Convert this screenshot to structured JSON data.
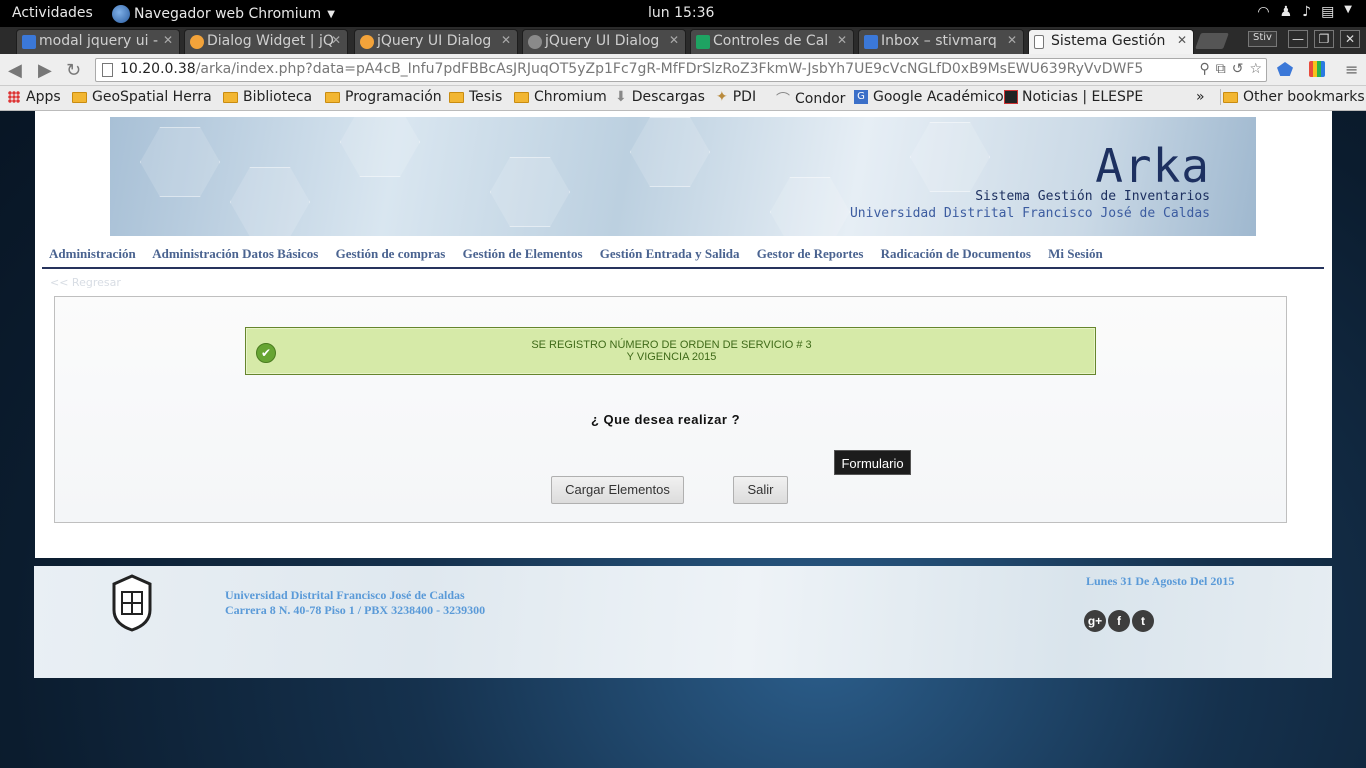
{
  "desktop": {
    "activities": "Actividades",
    "app_name": "Navegador web Chromium",
    "clock": "lun 15:36"
  },
  "tabs": [
    {
      "title": "modal jquery ui -",
      "icon_color": "#3b78d8"
    },
    {
      "title": "Dialog Widget | jQ",
      "icon_color": "#f3a33a"
    },
    {
      "title": "jQuery UI Dialog",
      "icon_color": "#f3a33a"
    },
    {
      "title": "jQuery UI Dialog",
      "icon_color": "#8a8a8a"
    },
    {
      "title": "Controles de Cal",
      "icon_color": "#1ea362"
    },
    {
      "title": "Inbox – stivmarq",
      "icon_color": "#3b78d8"
    },
    {
      "title": "Sistema Gestión",
      "icon_color": "#ffffff",
      "active": true
    }
  ],
  "browser": {
    "profile": "Stiv",
    "url_host": "10.20.0.38",
    "url_path": "/arka/index.php?data=pA4cB_Infu7pdFBBcAsJRJuqOT5yZp1Fc7gR-MfFDrSlzRoZ3FkmW-JsbYh7UE9cVcNGLfD0xB9MsEWU639RyVvDWF5"
  },
  "bookmarks": {
    "apps": "Apps",
    "items": [
      "GeoSpatial Herra",
      "Biblioteca",
      "Programación",
      "Tesis",
      "Chromium",
      "Descargas",
      "PDI",
      "Condor",
      "Google Académico",
      "Noticias | ELESPE"
    ],
    "more": "»",
    "other": "Other bookmarks"
  },
  "banner": {
    "title": "Arka",
    "subtitle": "Sistema Gestión de Inventarios",
    "university": "Universidad Distrital Francisco José de Caldas"
  },
  "menu": [
    "Administración",
    "Administración Datos Básicos",
    "Gestión de compras",
    "Gestión de Elementos",
    "Gestión Entrada y Salida",
    "Gestor de Reportes",
    "Radicación de Documentos",
    "Mi Sesión"
  ],
  "back_link": "<< Regresar",
  "alert": {
    "line1": "SE REGISTRO NÚMERO DE ORDEN DE SERVICIO # 3",
    "line2": "Y VIGENCIA 2015"
  },
  "question": "¿ Que desea realizar ?",
  "buttons": {
    "load": "Cargar Elementos",
    "exit": "Salir"
  },
  "tooltip": "Formulario",
  "footer": {
    "university": "Universidad Distrital Francisco José de Caldas",
    "address": "Carrera 8 N. 40-78 Piso 1 / PBX 3238400 - 3239300",
    "date": "Lunes 31 De Agosto Del 2015"
  }
}
